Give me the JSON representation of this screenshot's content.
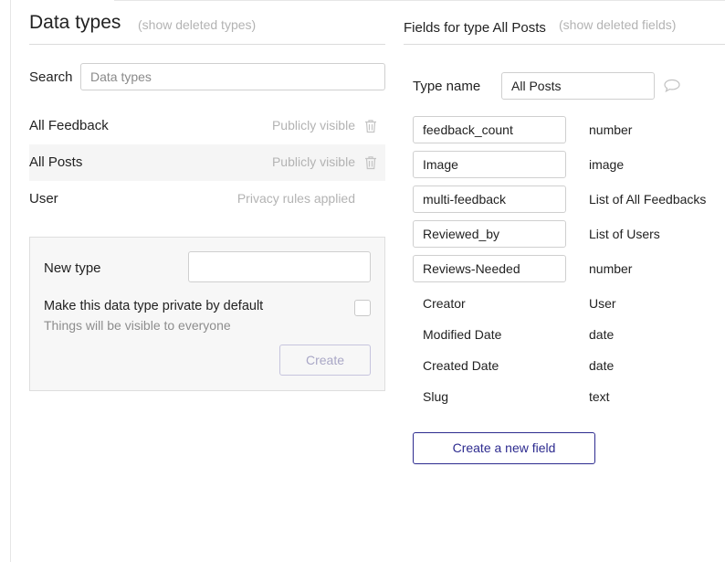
{
  "left": {
    "title": "Data types",
    "show_deleted_link": "(show deleted types)",
    "search": {
      "label": "Search",
      "placeholder": "Data types",
      "value": ""
    },
    "types": [
      {
        "name": "All Feedback",
        "privacy": "Publicly visible",
        "selected": false,
        "deletable": true
      },
      {
        "name": "All Posts",
        "privacy": "Publicly visible",
        "selected": true,
        "deletable": true
      },
      {
        "name": "User",
        "privacy": "Privacy rules applied",
        "selected": false,
        "deletable": false
      }
    ],
    "new_type": {
      "label": "New type",
      "value": "",
      "private_label": "Make this data type private by default",
      "private_hint": "Things will be visible to everyone",
      "private_checked": false,
      "create_label": "Create"
    }
  },
  "right": {
    "title": "Fields for type All Posts",
    "show_deleted_link": "(show deleted fields)",
    "type_name_label": "Type name",
    "type_name_value": "All Posts",
    "custom_fields": [
      {
        "name": "feedback_count",
        "type": "number"
      },
      {
        "name": "Image",
        "type": "image"
      },
      {
        "name": "multi-feedback",
        "type": "List of All Feedbacks"
      },
      {
        "name": "Reviewed_by",
        "type": "List of Users"
      },
      {
        "name": "Reviews-Needed",
        "type": "number"
      }
    ],
    "builtin_fields": [
      {
        "name": "Creator",
        "type": "User"
      },
      {
        "name": "Modified Date",
        "type": "date"
      },
      {
        "name": "Created Date",
        "type": "date"
      },
      {
        "name": "Slug",
        "type": "text"
      }
    ],
    "create_field_label": "Create a new field"
  },
  "colors": {
    "accent": "#2d2b8f",
    "muted": "#b3b3b3",
    "selected_row": "#f5f5f5"
  },
  "icons": {
    "delete": "trash-icon",
    "comment": "comment-bubble-icon"
  }
}
